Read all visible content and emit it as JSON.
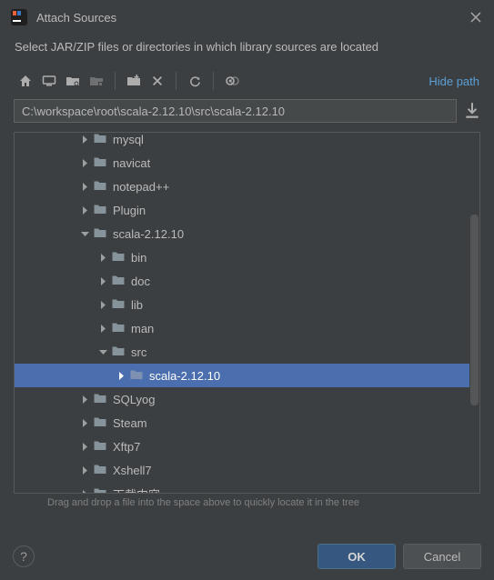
{
  "window": {
    "title": "Attach Sources",
    "subtitle": "Select JAR/ZIP files or directories in which library sources are located"
  },
  "toolbar": {
    "hide_path_label": "Hide path"
  },
  "path": {
    "value": "C:\\workspace\\root\\scala-2.12.10\\src\\scala-2.12.10"
  },
  "tree": {
    "items": [
      {
        "label": "mysql",
        "depth": 3,
        "expanded": false,
        "selected": false
      },
      {
        "label": "navicat",
        "depth": 3,
        "expanded": false,
        "selected": false
      },
      {
        "label": "notepad++",
        "depth": 3,
        "expanded": false,
        "selected": false
      },
      {
        "label": "Plugin",
        "depth": 3,
        "expanded": false,
        "selected": false
      },
      {
        "label": "scala-2.12.10",
        "depth": 3,
        "expanded": true,
        "selected": false
      },
      {
        "label": "bin",
        "depth": 4,
        "expanded": false,
        "selected": false
      },
      {
        "label": "doc",
        "depth": 4,
        "expanded": false,
        "selected": false
      },
      {
        "label": "lib",
        "depth": 4,
        "expanded": false,
        "selected": false
      },
      {
        "label": "man",
        "depth": 4,
        "expanded": false,
        "selected": false
      },
      {
        "label": "src",
        "depth": 4,
        "expanded": true,
        "selected": false
      },
      {
        "label": "scala-2.12.10",
        "depth": 5,
        "expanded": false,
        "selected": true
      },
      {
        "label": "SQLyog",
        "depth": 3,
        "expanded": false,
        "selected": false
      },
      {
        "label": "Steam",
        "depth": 3,
        "expanded": false,
        "selected": false
      },
      {
        "label": "Xftp7",
        "depth": 3,
        "expanded": false,
        "selected": false
      },
      {
        "label": "Xshell7",
        "depth": 3,
        "expanded": false,
        "selected": false
      },
      {
        "label": "下载内容",
        "depth": 3,
        "expanded": false,
        "selected": false,
        "cutoff": true
      }
    ]
  },
  "hint": "Drag and drop a file into the space above to quickly locate it in the tree",
  "footer": {
    "ok": "OK",
    "cancel": "Cancel"
  }
}
